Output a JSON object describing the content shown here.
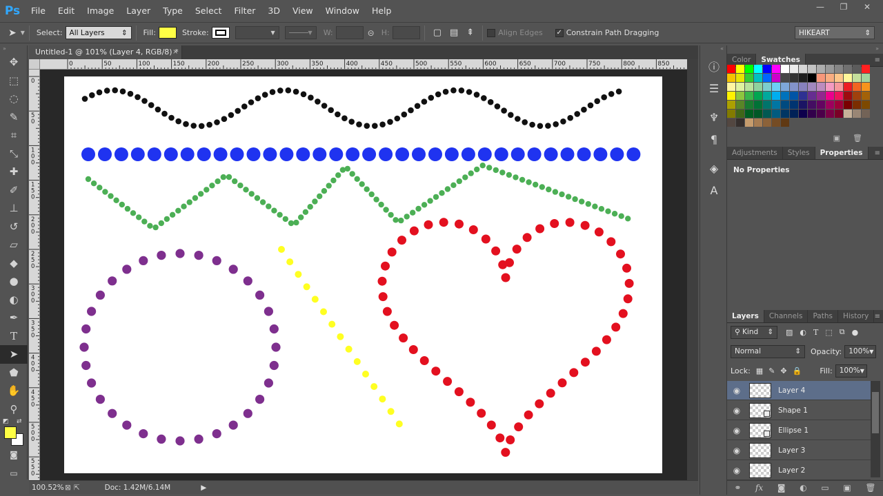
{
  "app": {
    "logo": "Ps",
    "accent": "#31a8ff"
  },
  "menu": [
    "File",
    "Edit",
    "Image",
    "Layer",
    "Type",
    "Select",
    "Filter",
    "3D",
    "View",
    "Window",
    "Help"
  ],
  "window_buttons": [
    "—",
    "❐",
    "✕"
  ],
  "options": {
    "select_label": "Select:",
    "select_value": "All Layers",
    "fill_label": "Fill:",
    "fill_color": "#ffff45",
    "stroke_label": "Stroke:",
    "w_label": "W:",
    "h_label": "H:",
    "align_edges": "Align Edges",
    "constrain": "Constrain Path Dragging",
    "workspace": "HIKEART"
  },
  "document": {
    "tab_title": "Untitled-1 @ 101% (Layer 4, RGB/8) *",
    "tab_close": "×",
    "zoom": "100.52%",
    "doc_info": "Doc: 1.42M/6.14M"
  },
  "rulers": {
    "h_ticks": [
      "0",
      "50",
      "100",
      "150",
      "200",
      "250",
      "300",
      "350",
      "400",
      "450",
      "500",
      "550",
      "600",
      "650",
      "700",
      "750",
      "800",
      "850"
    ],
    "v_ticks": [
      "0",
      "5\n0",
      "1\n0\n0",
      "1\n5\n0",
      "2\n0\n0",
      "2\n5\n0",
      "3\n0\n0",
      "3\n5\n0",
      "4\n0\n0",
      "4\n5\n0",
      "5\n0\n0",
      "5\n5\n0"
    ]
  },
  "artwork": {
    "colors": {
      "black": "#111111",
      "blue": "#1f33f0",
      "green": "#4caf55",
      "purple": "#7e2f8e",
      "yellow": "#ffff22",
      "red": "#e3101f"
    }
  },
  "swatches_panel": {
    "tabs": [
      "Color",
      "Swatches"
    ],
    "active": "Swatches"
  },
  "properties_panel": {
    "tabs": [
      "Adjustments",
      "Styles",
      "Properties"
    ],
    "active": "Properties",
    "body": "No Properties"
  },
  "layers_panel": {
    "tabs": [
      "Layers",
      "Channels",
      "Paths",
      "History"
    ],
    "active": "Layers",
    "filter_kind": "Kind",
    "blend_mode": "Normal",
    "opacity_label": "Opacity:",
    "opacity": "100%",
    "lock_label": "Lock:",
    "fill_label": "Fill:",
    "fill": "100%",
    "layers": [
      {
        "name": "Layer 4",
        "selected": true,
        "kind": "raster"
      },
      {
        "name": "Shape 1",
        "selected": false,
        "kind": "shape"
      },
      {
        "name": "Ellipse 1",
        "selected": false,
        "kind": "shape"
      },
      {
        "name": "Layer 3",
        "selected": false,
        "kind": "raster"
      },
      {
        "name": "Layer 2",
        "selected": false,
        "kind": "raster"
      }
    ]
  }
}
